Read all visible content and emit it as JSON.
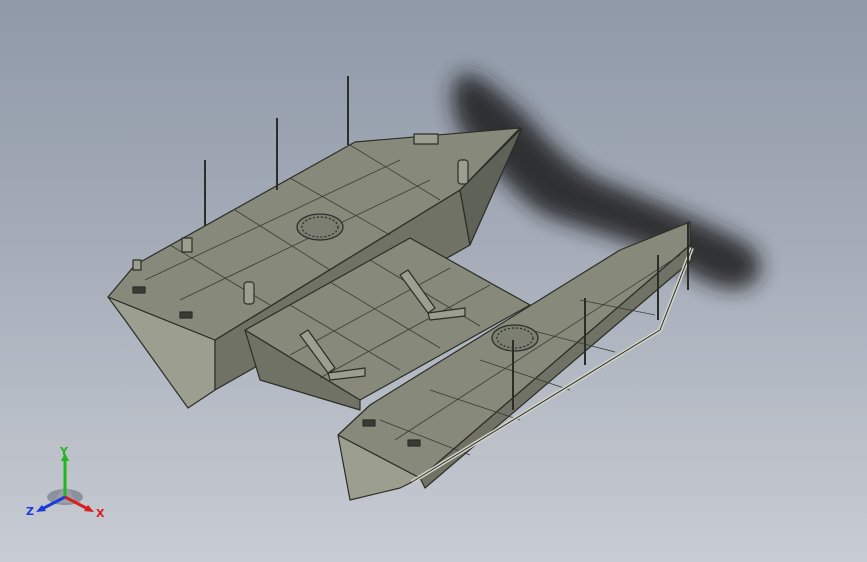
{
  "viewport": {
    "background_top": "#8f99a8",
    "background_bottom": "#c8ccd3",
    "model": "catamaran-pontoon-barge"
  },
  "triad": {
    "x_label": "X",
    "y_label": "Y",
    "z_label": "Z",
    "x_color": "#d81e1e",
    "y_color": "#1fb81f",
    "z_color": "#1e3ad8"
  },
  "colors": {
    "hull_top": "#878a7b",
    "hull_side": "#6f7264",
    "hull_end": "#9c9f90",
    "edge": "#2b2d27",
    "shadow": "#1c1c1c"
  }
}
